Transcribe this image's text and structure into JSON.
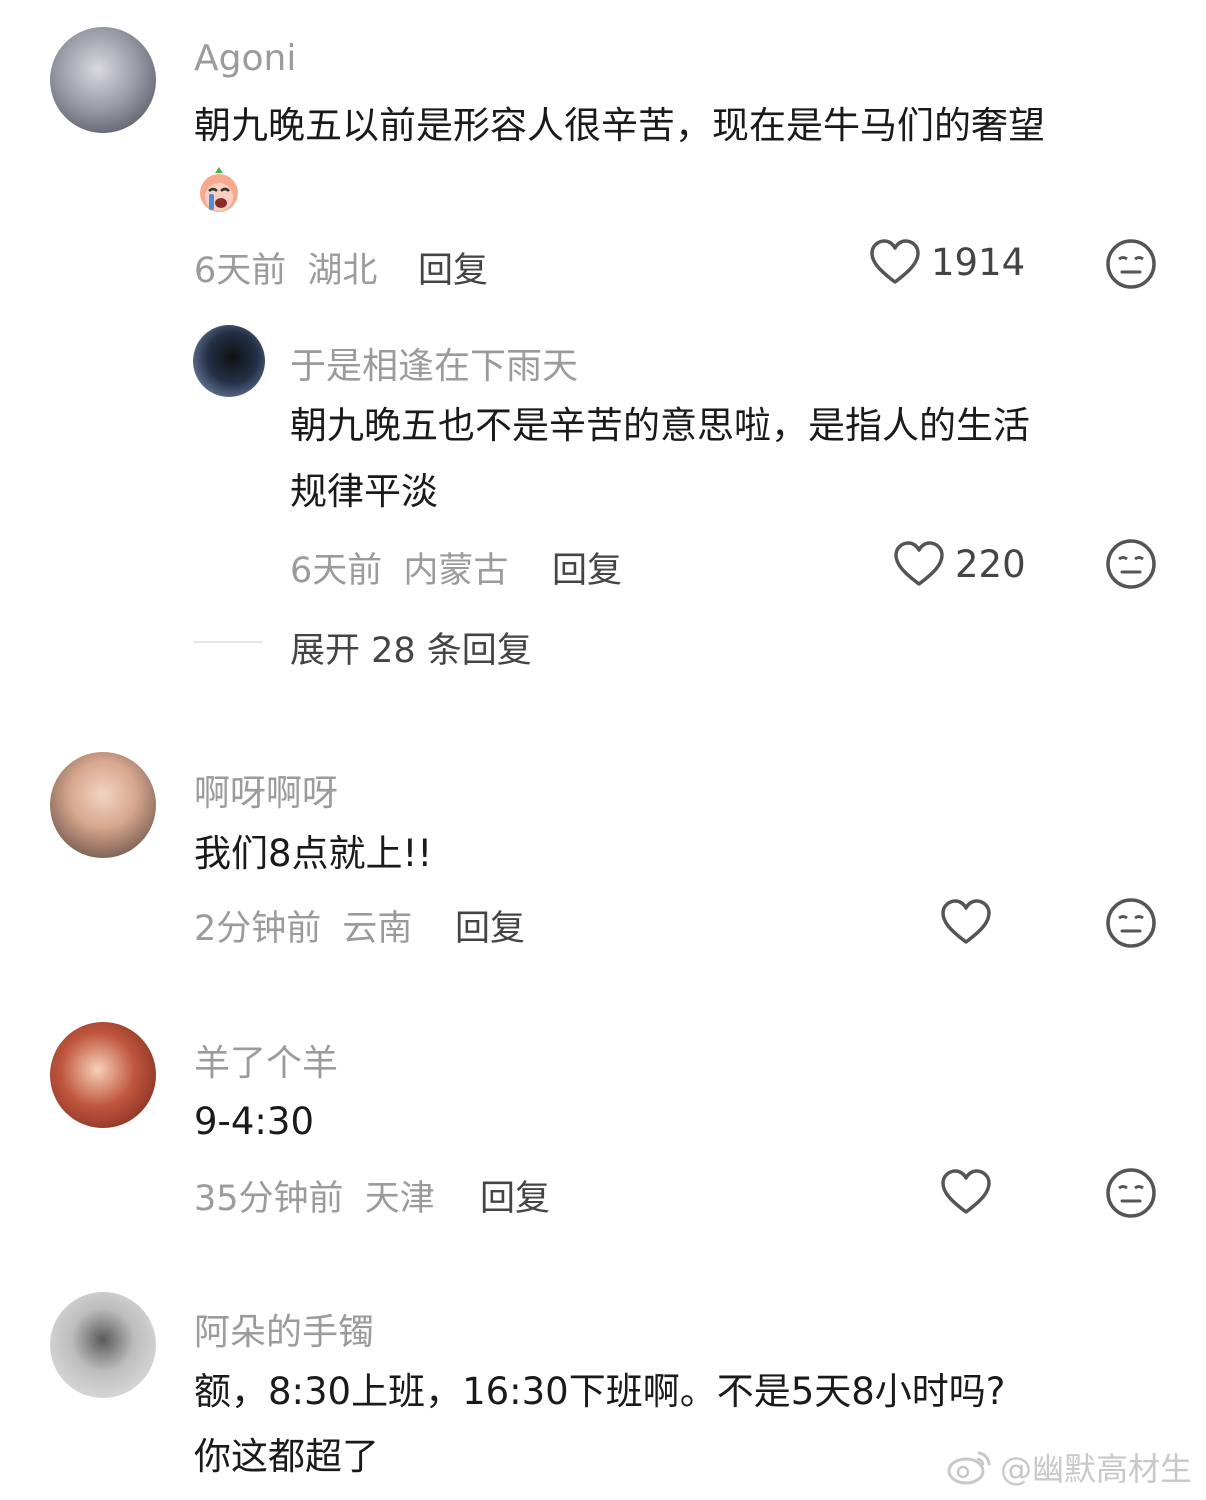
{
  "comments": [
    {
      "name": "Agoni",
      "text": "朝九晚五以前是形容人很辛苦，现在是牛马们的奢望",
      "time": "6天前",
      "location": "湖北",
      "reply_label": "回复",
      "likes": "1914",
      "avatar_color": "#7a7d86"
    },
    {
      "name": "于是相逢在下雨天",
      "text_line1": "朝九晚五也不是辛苦的意思啦，是指人的生活",
      "text_line2": "规律平淡",
      "time": "6天前",
      "location": "内蒙古",
      "reply_label": "回复",
      "likes": "220",
      "avatar_color": "#2d3a55"
    },
    {
      "name": "啊呀啊呀",
      "text": "我们8点就上!!",
      "time": "2分钟前",
      "location": "云南",
      "reply_label": "回复",
      "avatar_color": "#c7a08a"
    },
    {
      "name": "羊了个羊",
      "text": "9-4:30",
      "time": "35分钟前",
      "location": "天津",
      "reply_label": "回复",
      "avatar_color": "#9b3b2a"
    },
    {
      "name": "阿朵的手镯",
      "text_line1": "额，8:30上班，16:30下班啊。不是5天8小时吗?",
      "text_line2": "你这都超了",
      "avatar_color": "#bdbdbd"
    }
  ],
  "expand_replies": "展开 28 条回复",
  "watermark": "@幽默高材生",
  "colors": {
    "meta": "#9b9b9b",
    "text": "#1a1a1a",
    "icon": "#555555"
  }
}
